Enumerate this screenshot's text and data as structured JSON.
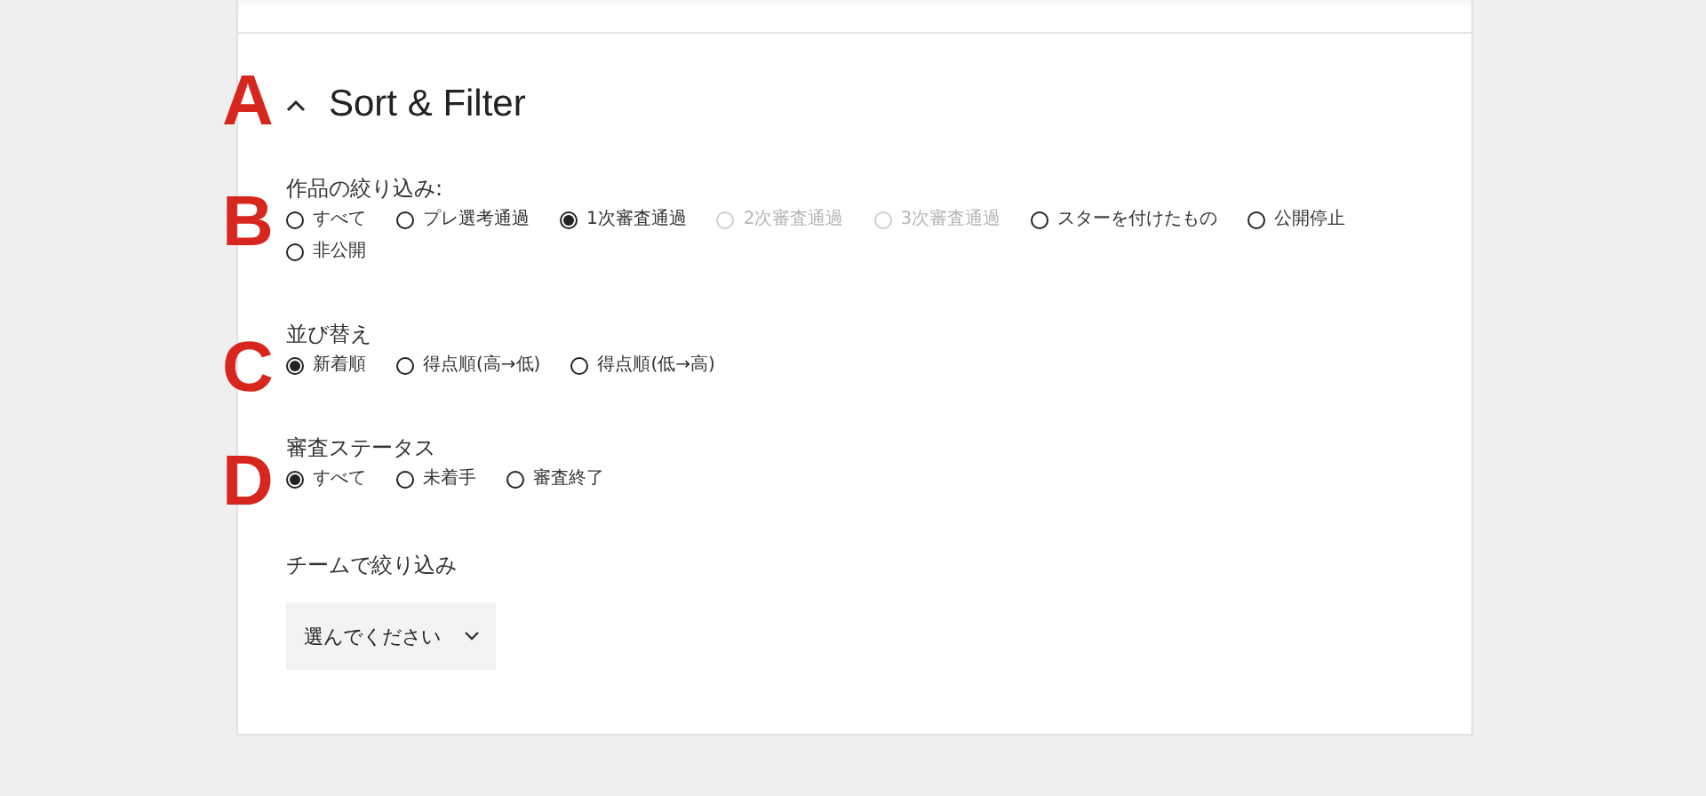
{
  "header": {
    "marker": "A",
    "expanded": true,
    "title": "Sort & Filter"
  },
  "sections": [
    {
      "kind": "radio",
      "marker": "B",
      "label": "作品の絞り込み:",
      "options": [
        {
          "label": "すべて",
          "selected": false,
          "disabled": false
        },
        {
          "label": "プレ選考通過",
          "selected": false,
          "disabled": false
        },
        {
          "label": "1次審査通過",
          "selected": true,
          "disabled": false
        },
        {
          "label": "2次審査通過",
          "selected": false,
          "disabled": true
        },
        {
          "label": "3次審査通過",
          "selected": false,
          "disabled": true
        },
        {
          "label": "スターを付けたもの",
          "selected": false,
          "disabled": false
        },
        {
          "label": "公開停止",
          "selected": false,
          "disabled": false
        },
        {
          "label": "非公開",
          "selected": false,
          "disabled": false
        }
      ]
    },
    {
      "kind": "radio",
      "marker": "C",
      "label": "並び替え",
      "options": [
        {
          "label": "新着順",
          "selected": true,
          "disabled": false
        },
        {
          "label": "得点順(高→低)",
          "selected": false,
          "disabled": false
        },
        {
          "label": "得点順(低→高)",
          "selected": false,
          "disabled": false
        }
      ]
    },
    {
      "kind": "radio",
      "marker": "D",
      "label": "審査ステータス",
      "options": [
        {
          "label": "すべて",
          "selected": true,
          "disabled": false
        },
        {
          "label": "未着手",
          "selected": false,
          "disabled": false
        },
        {
          "label": "審査終了",
          "selected": false,
          "disabled": false
        }
      ]
    },
    {
      "kind": "select",
      "label": "チームで絞り込み",
      "value": "選んでください"
    }
  ]
}
